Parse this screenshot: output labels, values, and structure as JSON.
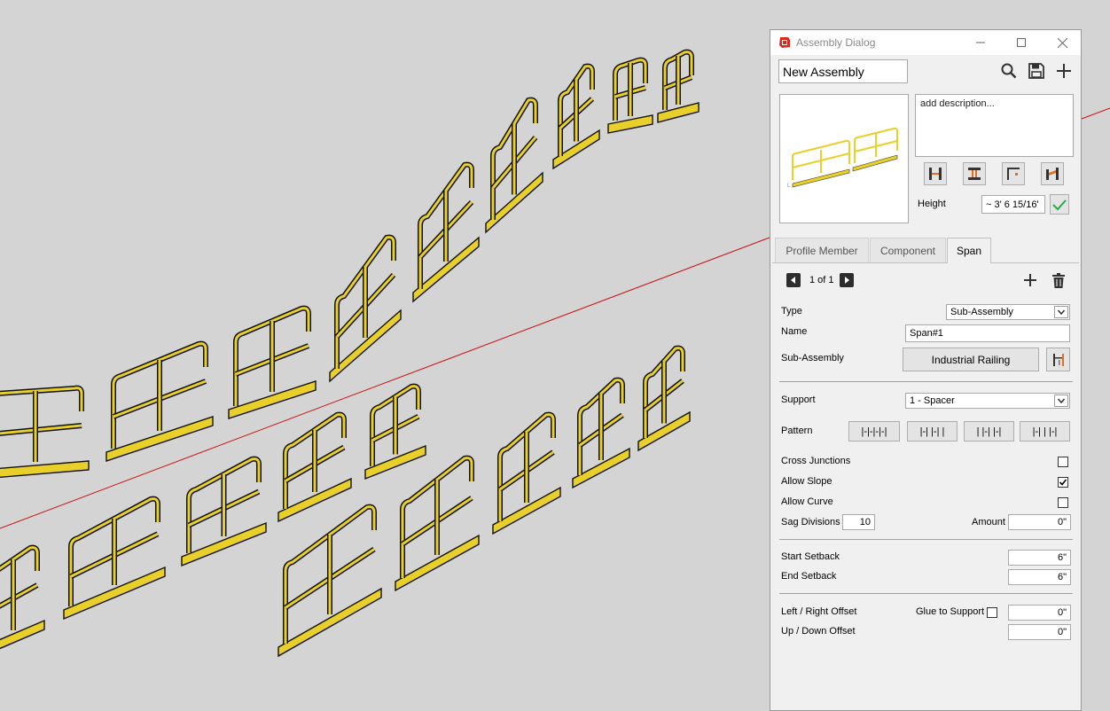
{
  "window": {
    "title": "Assembly Dialog"
  },
  "toolbar": {
    "assembly_name": "New Assembly"
  },
  "description": {
    "placeholder": "add description..."
  },
  "height": {
    "label": "Height",
    "value": "~ 3' 6 15/16'"
  },
  "tabs": [
    {
      "label": "Profile Member",
      "active": false
    },
    {
      "label": "Component",
      "active": false
    },
    {
      "label": "Span",
      "active": true
    }
  ],
  "pager": {
    "text": "1 of 1"
  },
  "form": {
    "type_label": "Type",
    "type_value": "Sub-Assembly",
    "name_label": "Name",
    "name_value": "Span#1",
    "subassembly_label": "Sub-Assembly",
    "subassembly_value": "Industrial Railing",
    "support_label": "Support",
    "support_value": "1 - Spacer",
    "pattern_label": "Pattern",
    "patterns": [
      "|-|-|-|-|",
      "|-| |-| |",
      "| |-| |-|",
      "|-| | |-|"
    ],
    "cross_junctions_label": "Cross Junctions",
    "cross_junctions_checked": false,
    "allow_slope_label": "Allow Slope",
    "allow_slope_checked": true,
    "allow_curve_label": "Allow Curve",
    "allow_curve_checked": false,
    "sag_divisions_label": "Sag Divisions",
    "sag_divisions_value": "10",
    "amount_label": "Amount",
    "amount_value": "0\"",
    "start_setback_label": "Start Setback",
    "start_setback_value": "6\"",
    "end_setback_label": "End Setback",
    "end_setback_value": "6\"",
    "lr_offset_label": "Left / Right Offset",
    "glue_label": "Glue to Support",
    "glue_checked": false,
    "lr_offset_value": "0\"",
    "ud_offset_label": "Up / Down Offset",
    "ud_offset_value": "0\""
  },
  "colors": {
    "railing": "#e8cf2a",
    "axis_red": "#cc1010",
    "viewport_bg": "#d4d4d4",
    "dialog_bg": "#f0f0f0"
  }
}
